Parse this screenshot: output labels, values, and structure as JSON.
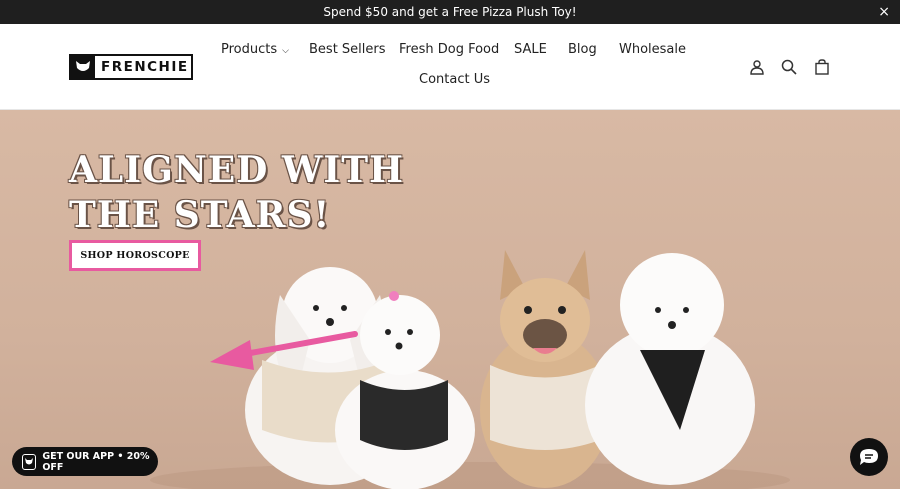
{
  "announcement": {
    "text": "Spend $50 and get a Free Pizza Plush Toy!",
    "close_label": "×"
  },
  "brand": {
    "name": "FRENCHIE"
  },
  "nav": {
    "products": "Products",
    "best_sellers": "Best Sellers",
    "fresh_dog_food": "Fresh Dog Food",
    "sale": "SALE",
    "blog": "Blog",
    "wholesale": "Wholesale",
    "contact_us": "Contact Us"
  },
  "icons": {
    "account": "account-icon",
    "search": "search-icon",
    "cart": "cart-icon"
  },
  "hero": {
    "headline_line1": "ALIGNED WITH",
    "headline_line2": "THE STARS!",
    "button_label": "SHOP HOROSCOPE",
    "accent_color": "#e85aa0"
  },
  "app_banner": {
    "label": "GET OUR APP • 20% OFF"
  }
}
